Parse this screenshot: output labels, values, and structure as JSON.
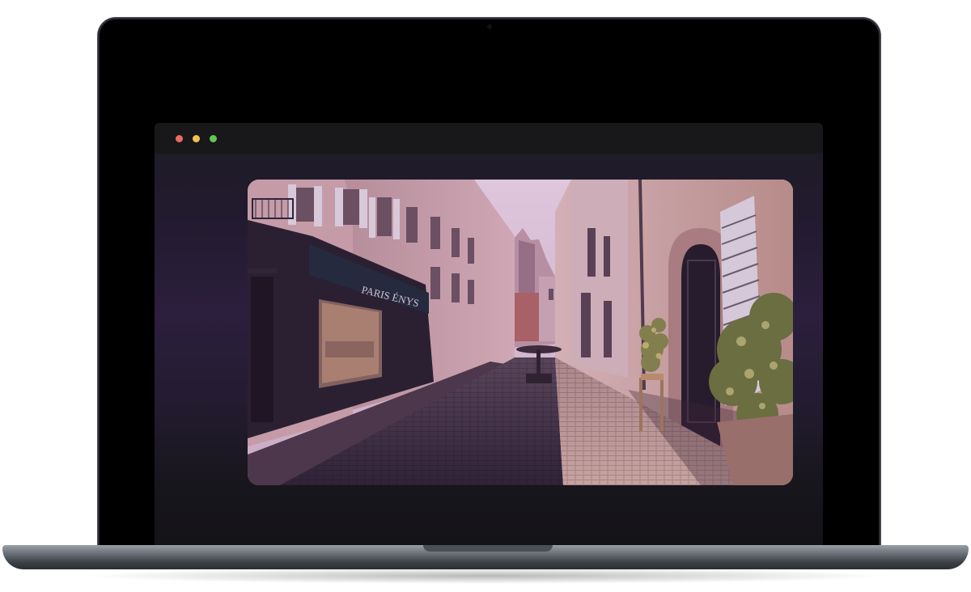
{
  "window": {
    "controls": [
      "close",
      "minimize",
      "maximize"
    ]
  },
  "photo": {
    "subject": "street-photo",
    "shop_sign": "PARIS ÉNYS"
  },
  "colors": {
    "window_close": "#ed6a5e",
    "window_minimize": "#f5bf4f",
    "window_maximize": "#62c554",
    "sky": "#ecd6e6",
    "bezel": "#000000"
  }
}
